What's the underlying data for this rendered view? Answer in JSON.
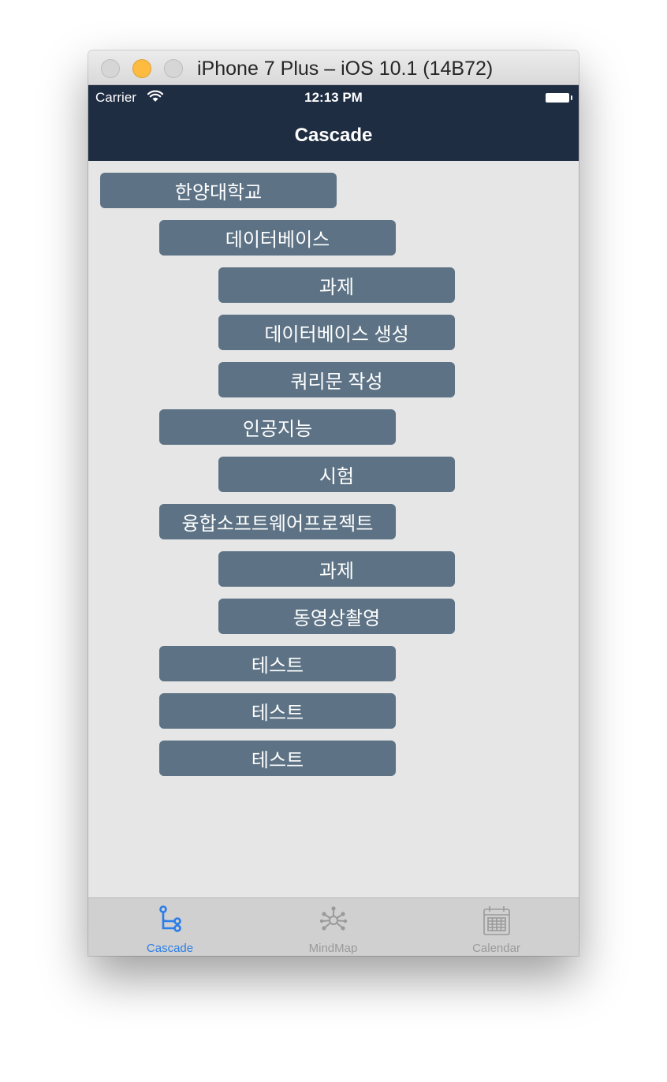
{
  "window": {
    "title": "iPhone 7 Plus – iOS 10.1 (14B72)"
  },
  "status_bar": {
    "carrier": "Carrier",
    "time": "12:13 PM"
  },
  "nav": {
    "title": "Cascade"
  },
  "nodes": [
    {
      "label": "한양대학교",
      "level": 0
    },
    {
      "label": "데이터베이스",
      "level": 1
    },
    {
      "label": "과제",
      "level": 2
    },
    {
      "label": "데이터베이스 생성",
      "level": 2
    },
    {
      "label": "쿼리문 작성",
      "level": 2
    },
    {
      "label": "인공지능",
      "level": 1
    },
    {
      "label": "시험",
      "level": 2
    },
    {
      "label": "융합소프트웨어프로젝트",
      "level": 1
    },
    {
      "label": "과제",
      "level": 2
    },
    {
      "label": "동영상촬영",
      "level": 2
    },
    {
      "label": "테스트",
      "level": 1
    },
    {
      "label": "테스트",
      "level": 1
    },
    {
      "label": "테스트",
      "level": 1
    }
  ],
  "fab": {
    "icon": "plus-icon"
  },
  "tabs": [
    {
      "label": "Cascade",
      "icon": "cascade-tree-icon",
      "selected": true
    },
    {
      "label": "MindMap",
      "icon": "mindmap-icon",
      "selected": false
    },
    {
      "label": "Calendar",
      "icon": "calendar-icon",
      "selected": false
    }
  ],
  "colors": {
    "nav_background": "#1f2d43",
    "node_background": "#5d7385",
    "content_background": "#e6e6e7",
    "tab_active": "#2b7de9",
    "tab_inactive": "#9a9a9a"
  }
}
